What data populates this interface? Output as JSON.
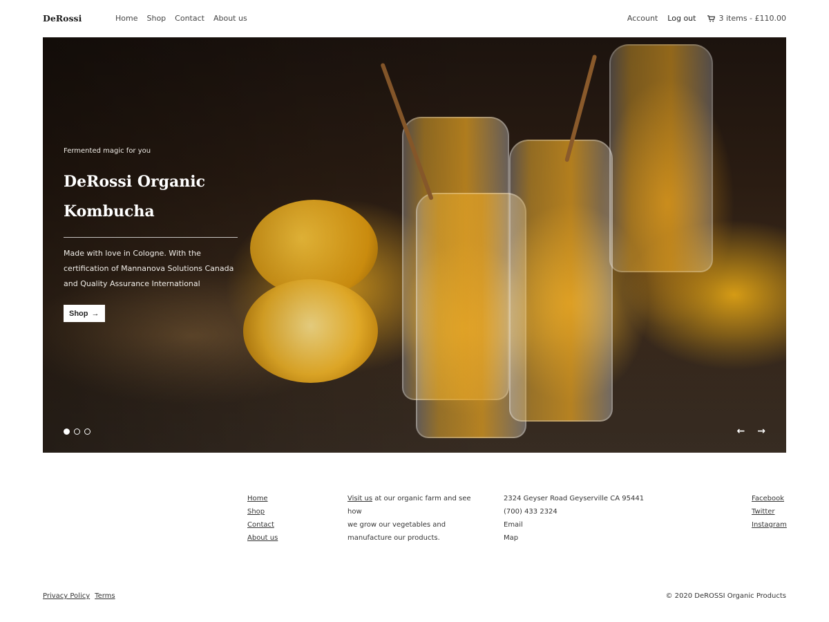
{
  "header": {
    "logo": "DeRossi",
    "nav": [
      "Home",
      "Shop",
      "Contact",
      "About us"
    ],
    "account": "Account",
    "logout": "Log out",
    "cart_icon": "cart-icon",
    "cart": "3 items - £110.00"
  },
  "hero": {
    "eyebrow": "Fermented magic for you",
    "title_line1": "DeRossi Organic",
    "title_line2": "Kombucha",
    "desc_line1": "Made with love in Cologne. With the",
    "desc_line2": "certification of Mannanova Solutions Canada",
    "desc_line3": "and Quality Assurance International",
    "button_label": "Shop",
    "button_icon": "arrow-right-icon",
    "slides": 3,
    "active_slide": 1,
    "prev_icon": "arrow-left-icon",
    "next_icon": "arrow-right-icon"
  },
  "footer": {
    "links": [
      "Home",
      "Shop",
      "Contact",
      "About us"
    ],
    "visit_link": "Visit us",
    "visit_text_1": " at our organic farm and see how",
    "visit_text_2": "we grow our vegetables and",
    "visit_text_3": "manufacture our products.",
    "address": "2324 Geyser Road Geyserville CA 95441",
    "phone": "(700) 433 2324",
    "email": "Email",
    "map": "Map",
    "social": [
      "Facebook",
      "Twitter",
      "Instagram"
    ],
    "privacy": "Privacy Policy",
    "terms": "Terms",
    "copyright": "© 2020 DeROSSI Organic Products"
  },
  "colors": {
    "text": "#333333",
    "white": "#ffffff",
    "hero_dark": "#1c130e",
    "accent_amber": "#e0a62a"
  }
}
